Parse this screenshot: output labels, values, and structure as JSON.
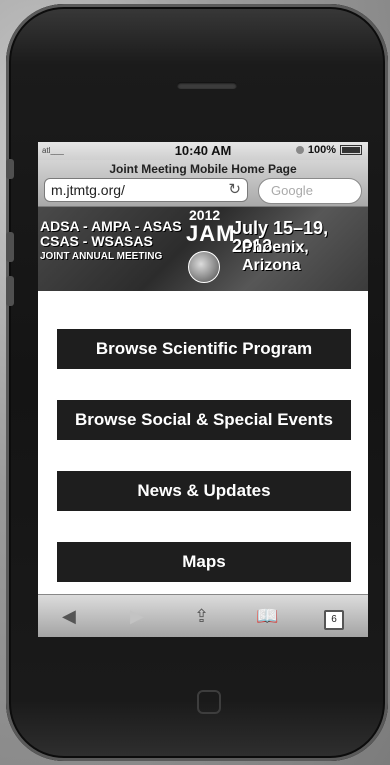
{
  "status_bar": {
    "signal": "atl___",
    "time": "10:40 AM",
    "battery": "100%"
  },
  "browser": {
    "page_title": "Joint Meeting Mobile Home Page",
    "url": "m.jtmtg.org/",
    "search_placeholder": "Google"
  },
  "banner": {
    "orgs_line1": "ADSA - AMPA - ASAS",
    "orgs_line2": "CSAS - WSASAS",
    "orgs_line3": "JOINT ANNUAL MEETING",
    "year": "2012",
    "jam": "JAM",
    "dates": "July 15–19, 2012",
    "location": "Phoenix, Arizona"
  },
  "menu": {
    "items": [
      {
        "label": "Browse Scientific Program"
      },
      {
        "label": "Browse Social & Special Events"
      },
      {
        "label": "News & Updates"
      },
      {
        "label": "Maps"
      }
    ]
  },
  "toolbar": {
    "tab_count": "6"
  }
}
